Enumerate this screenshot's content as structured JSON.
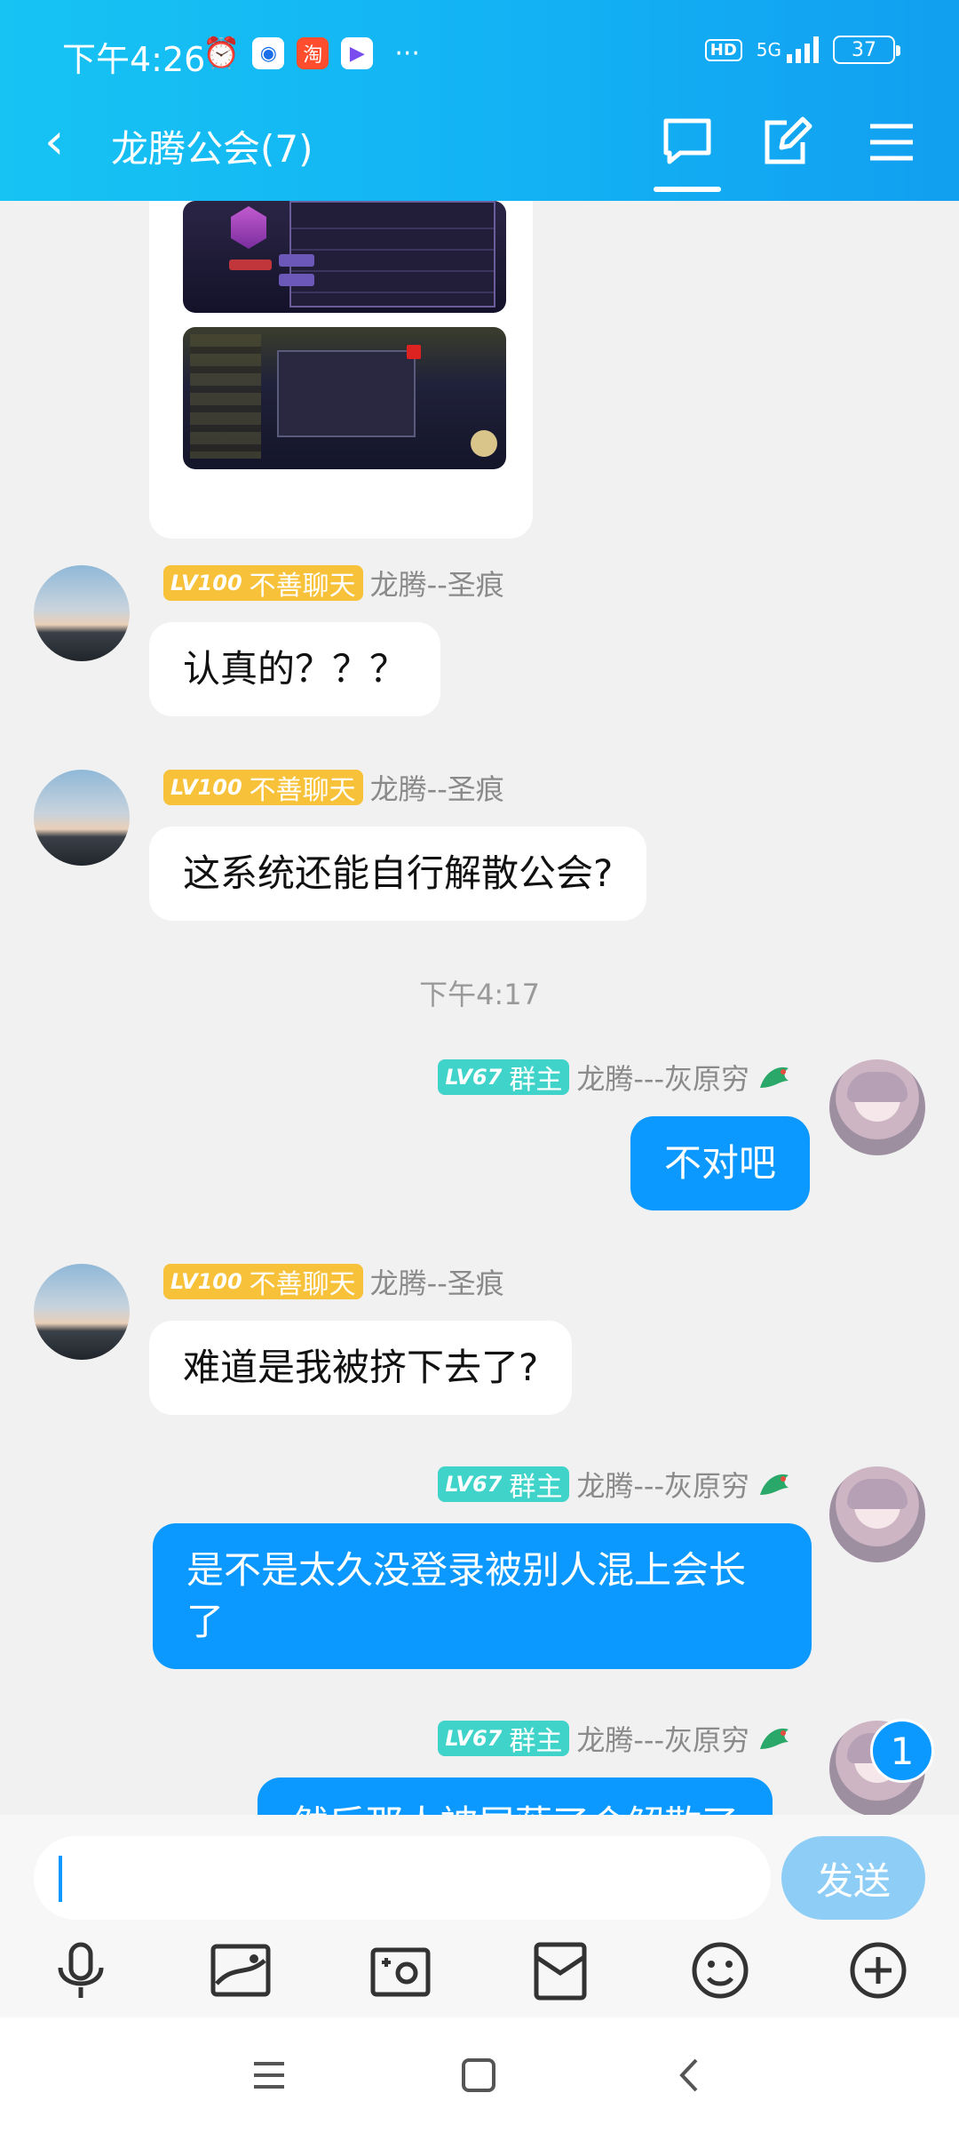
{
  "status_bar": {
    "time": "下午4:26",
    "more": "···",
    "hd": "HD",
    "network": "5G",
    "battery": "37"
  },
  "header": {
    "back": "‹",
    "title": "龙腾公会(7)"
  },
  "messages": [
    {
      "side": "left",
      "level": "LV100",
      "tag": "不善聊天",
      "name": "龙腾--圣痕",
      "text": "认真的？？？"
    },
    {
      "side": "left",
      "level": "LV100",
      "tag": "不善聊天",
      "name": "龙腾--圣痕",
      "text": "这系统还能自行解散公会?"
    },
    {
      "side": "right",
      "level": "LV67",
      "tag": "群主",
      "name": "龙腾---灰原穷",
      "text": "不对吧"
    },
    {
      "side": "left",
      "level": "LV100",
      "tag": "不善聊天",
      "name": "龙腾--圣痕",
      "text": "难道是我被挤下去了?"
    },
    {
      "side": "right",
      "level": "LV67",
      "tag": "群主",
      "name": "龙腾---灰原穷",
      "text": "是不是太久没登录被别人混上会长了"
    },
    {
      "side": "right",
      "level": "LV67",
      "tag": "群主",
      "name": "龙腾---灰原穷",
      "text": "然后那人被屏蔽了会解散了"
    }
  ],
  "timestamp": "下午4:17",
  "unread_count": "1",
  "input": {
    "placeholder": "",
    "send_label": "发送"
  },
  "colors": {
    "header": "#13b2f4",
    "bubble_right": "#0b99ff",
    "bubble_left": "#ffffff",
    "level_gold": "#f7c23a",
    "level_teal": "#40d3c9"
  }
}
